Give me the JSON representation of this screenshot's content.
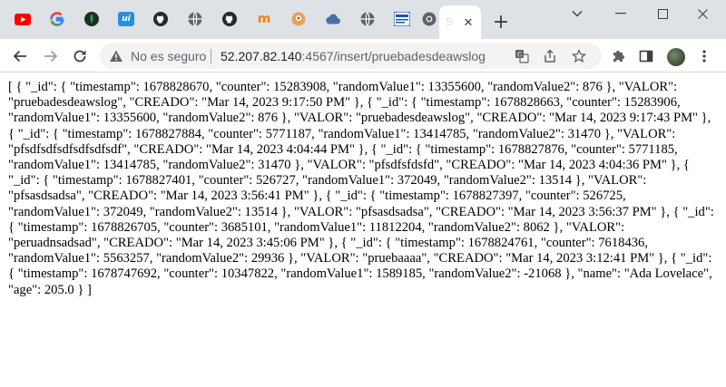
{
  "tabs": [
    {
      "icon": "youtube-icon",
      "color": "#ff0000"
    },
    {
      "icon": "google-icon",
      "color": "#4285f4"
    },
    {
      "icon": "mongodb-icon",
      "color": "#13aa52"
    },
    {
      "icon": "uiverse-icon",
      "color": "#2b8fd8"
    },
    {
      "icon": "github-icon",
      "color": "#24292f"
    },
    {
      "icon": "globe-icon",
      "color": "#5f6368"
    },
    {
      "icon": "github-icon",
      "color": "#24292f"
    },
    {
      "icon": "moodle-icon",
      "color": "#f98012"
    },
    {
      "icon": "postman-icon",
      "color": "#e7a15a"
    },
    {
      "icon": "cloud-icon",
      "color": "#4a6fa5"
    },
    {
      "icon": "globe-icon",
      "color": "#5f6368"
    },
    {
      "icon": "mvn-icon",
      "color": "#1a56a8"
    },
    {
      "icon": "chrome-icon",
      "color": "#5f6368"
    }
  ],
  "active_tab": {
    "label": "S"
  },
  "address_bar": {
    "security_status": "No es seguro",
    "host": "52.207.82.140",
    "path": ":4567/insert/pruebadesdeawslog"
  },
  "page": {
    "json_text": "[ { \"_id\": { \"timestamp\": 1678828670, \"counter\": 15283908, \"randomValue1\": 13355600, \"randomValue2\": 876 }, \"VALOR\": \"pruebadesdeawslog\", \"CREADO\": \"Mar 14, 2023 9:17:50 PM\" }, { \"_id\": { \"timestamp\": 1678828663, \"counter\": 15283906, \"randomValue1\": 13355600, \"randomValue2\": 876 }, \"VALOR\": \"pruebadesdeawslog\", \"CREADO\": \"Mar 14, 2023 9:17:43 PM\" }, { \"_id\": { \"timestamp\": 1678827884, \"counter\": 5771187, \"randomValue1\": 13414785, \"randomValue2\": 31470 }, \"VALOR\": \"pfsdfsdfsdfsdfsdfsdf\", \"CREADO\": \"Mar 14, 2023 4:04:44 PM\" }, { \"_id\": { \"timestamp\": 1678827876, \"counter\": 5771185, \"randomValue1\": 13414785, \"randomValue2\": 31470 }, \"VALOR\": \"pfsdfsfdsfd\", \"CREADO\": \"Mar 14, 2023 4:04:36 PM\" }, { \"_id\": { \"timestamp\": 1678827401, \"counter\": 526727, \"randomValue1\": 372049, \"randomValue2\": 13514 }, \"VALOR\": \"pfsasdsadsa\", \"CREADO\": \"Mar 14, 2023 3:56:41 PM\" }, { \"_id\": { \"timestamp\": 1678827397, \"counter\": 526725, \"randomValue1\": 372049, \"randomValue2\": 13514 }, \"VALOR\": \"pfsasdsadsa\", \"CREADO\": \"Mar 14, 2023 3:56:37 PM\" }, { \"_id\": { \"timestamp\": 1678826705, \"counter\": 3685101, \"randomValue1\": 11812204, \"randomValue2\": 8062 }, \"VALOR\": \"peruadnsadsad\", \"CREADO\": \"Mar 14, 2023 3:45:06 PM\" }, { \"_id\": { \"timestamp\": 1678824761, \"counter\": 7618436, \"randomValue1\": 5563257, \"randomValue2\": 29936 }, \"VALOR\": \"pruebaaaa\", \"CREADO\": \"Mar 14, 2023 3:12:41 PM\" }, { \"_id\": { \"timestamp\": 1678747692, \"counter\": 10347822, \"randomValue1\": 1589185, \"randomValue2\": -21068 }, \"name\": \"Ada Lovelace\", \"age\": 205.0 } ]"
  }
}
